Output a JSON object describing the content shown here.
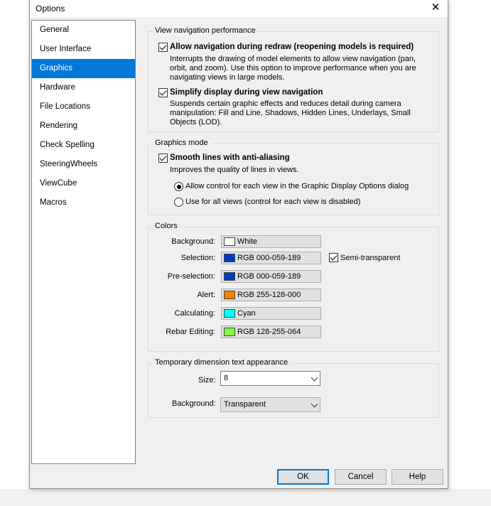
{
  "dialog": {
    "title": "Options",
    "close_glyph": "✕"
  },
  "nav": {
    "items": [
      "General",
      "User Interface",
      "Graphics",
      "Hardware",
      "File Locations",
      "Rendering",
      "Check Spelling",
      "SteeringWheels",
      "ViewCube",
      "Macros"
    ],
    "selected": "Graphics"
  },
  "view_nav": {
    "title": "View navigation performance",
    "allow_redraw": {
      "label": "Allow navigation during redraw (reopening models is required)",
      "checked": true,
      "desc": [
        "Interrupts the drawing of model elements to allow view navigation (pan,",
        "orbit, and zoom). Use this option to improve performance when you are",
        "navigating views in large models."
      ]
    },
    "simplify": {
      "label": "Simplify display during view navigation",
      "checked": true,
      "desc": [
        "Suspends certain graphic effects and reduces detail during camera",
        "manipulation: Fill and Line, Shadows, Hidden Lines, Underlays, Small",
        "Objects (LOD)."
      ]
    }
  },
  "graphics_mode": {
    "title": "Graphics mode",
    "smooth": {
      "label": "Smooth lines with anti-aliasing",
      "checked": true,
      "desc": "Improves the quality of lines in views."
    },
    "radio_allow": {
      "label": "Allow control for each view in the Graphic Display Options dialog",
      "selected": true
    },
    "radio_all": {
      "label": "Use for all views (control for each view is disabled)",
      "selected": false
    }
  },
  "colors": {
    "title": "Colors",
    "rows": [
      {
        "label": "Background:",
        "value": "White",
        "swatch": "#ffffff"
      },
      {
        "label": "Selection:",
        "value": "RGB 000-059-189",
        "swatch": "#003bbd"
      },
      {
        "label": "Pre-selection:",
        "value": "RGB 000-059-189",
        "swatch": "#003bbd"
      },
      {
        "label": "Alert:",
        "value": "RGB 255-128-000",
        "swatch": "#ff8000"
      },
      {
        "label": "Calculating:",
        "value": "Cyan",
        "swatch": "#00ffff"
      },
      {
        "label": "Rebar Editing:",
        "value": "RGB 128-255-064",
        "swatch": "#80ff40"
      }
    ],
    "semi_transparent": {
      "label": "Semi-transparent",
      "checked": true
    }
  },
  "temp_dim": {
    "title": "Temporary dimension text appearance",
    "size_label": "Size:",
    "size_value": "8",
    "bg_label": "Background:",
    "bg_value": "Transparent"
  },
  "buttons": {
    "ok": "OK",
    "cancel": "Cancel",
    "help": "Help"
  }
}
